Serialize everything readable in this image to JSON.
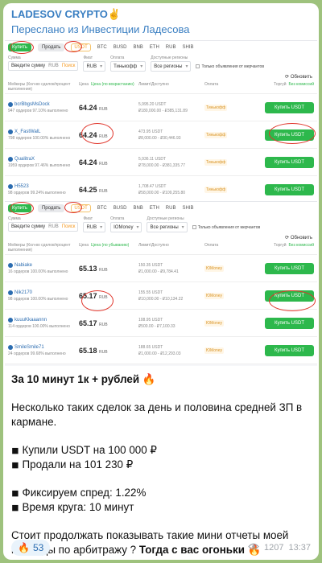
{
  "channel": {
    "name": "LADESOV CRYPTO✌️",
    "forwarded_from": "Переслано из Инвестиции Ладесова"
  },
  "shot1": {
    "tabs": {
      "buy": "Купить",
      "sell": "Продать",
      "assets": [
        "USDT",
        "BTC",
        "BUSD",
        "BNB",
        "ETH",
        "RUB",
        "SHIB"
      ]
    },
    "filters": {
      "amount_label": "Сумма",
      "amount_placeholder": "Введите сумму",
      "amount_currency": "RUB",
      "amount_search": "Поиск",
      "fiat_label": "Фиат",
      "fiat_value": "RUB",
      "payment_label": "Оплата",
      "payment_value": "Тинькофф",
      "regions_label": "Доступные регионы",
      "regions_value": "Все регионы",
      "merchant_check": "Только объявления от мерчантов"
    },
    "refresh": "Обновить",
    "headers": {
      "advertiser": "Мейкеры (Кол-во сделок/процент выполнения)",
      "price": "Цена",
      "price_sort": "Цена (по возрастанию)",
      "limit": "Лимит/Доступно",
      "payment": "Оплата",
      "trade": "Торгуй",
      "fee": "Без комиссий"
    },
    "rows": [
      {
        "name": "bcrBbgsMsDock",
        "sub": "947 ордеров   97.10% выполнено",
        "price": "64.24",
        "unit": "RUB",
        "avail": "5,995.20 USDT",
        "limit": "₽180,000.00 - ₽385,131.89",
        "pay": "Тинькофф",
        "action": "Купить USDT"
      },
      {
        "name": "X_FastWalL",
        "sub": "798 ордеров   100.00% выполнено",
        "price": "64.24",
        "unit": "RUB",
        "avail": "473.95 USDT",
        "limit": "₽8,000.00 - ₽30,446.93",
        "pay": "Тинькофф",
        "action": "Купить USDT"
      },
      {
        "name": "QualitraX",
        "sub": "1959 ордеров   97.46% выполнено",
        "price": "64.24",
        "unit": "RUB",
        "avail": "5,936.11 USDT",
        "limit": "₽78,000.00 - ₽381,335.77",
        "pay": "Тинькофф",
        "action": "Купить USDT"
      },
      {
        "name": "H5523",
        "sub": "98 ордеров   99.24% выполнено",
        "price": "64.25",
        "unit": "RUB",
        "avail": "1,708.47 USDT",
        "limit": "₽58,000.00 - ₽109,255.80",
        "pay": "Тинькофф",
        "action": "Купить USDT"
      }
    ]
  },
  "shot2": {
    "tabs": {
      "buy": "Купить",
      "sell": "Продать",
      "assets": [
        "USDT",
        "BTC",
        "BUSD",
        "BNB",
        "ETH",
        "RUB",
        "SHIB"
      ]
    },
    "filters": {
      "amount_label": "Сумма",
      "amount_placeholder": "Введите сумму",
      "amount_currency": "RUB",
      "amount_search": "Поиск",
      "fiat_label": "Фиат",
      "fiat_value": "RUB",
      "payment_label": "Оплата",
      "payment_value": "IOMoney",
      "regions_label": "Доступные регионы",
      "regions_value": "Все регионы",
      "merchant_check": "Только объявления от мерчантов"
    },
    "refresh": "Обновить",
    "headers": {
      "advertiser": "Мейкеры (Кол-во сделок/процент выполнения)",
      "price": "Цена",
      "price_sort": "Цена (по убыванию)",
      "limit": "Лимит/Доступно",
      "payment": "Оплата",
      "trade": "Торгуй",
      "fee": "Без комиссий"
    },
    "rows": [
      {
        "name": "Nabiake",
        "sub": "16 ордеров   100.00% выполнено",
        "price": "65.13",
        "unit": "RUB",
        "avail": "150.35 USDT",
        "limit": "₽1,000.00 - ₽9,784.41",
        "pay": "ЮMoney",
        "action": "Купить USDT"
      },
      {
        "name": "Nik2170",
        "sub": "98 ордеров   100.00% выполнено",
        "price": "65.17",
        "unit": "RUB",
        "avail": "155.55 USDT",
        "limit": "₽10,000.00 - ₽10,134.22",
        "pay": "ЮMoney",
        "action": "Купить USDT"
      },
      {
        "name": "kuuuKkaaannn",
        "sub": "114 ордеров   100.00% выполнено",
        "price": "65.17",
        "unit": "RUB",
        "avail": "108.95 USDT",
        "limit": "₽500.00 - ₽7,100.33",
        "pay": "ЮMoney",
        "action": "Купить USDT"
      },
      {
        "name": "SmileSmile71",
        "sub": "24 ордеров   99.68% выполнено",
        "price": "65.18",
        "unit": "RUB",
        "avail": "188.65 USDT",
        "limit": "₽1,000.00 - ₽12,293.03",
        "pay": "ЮMoney",
        "action": "Купить USDT"
      }
    ]
  },
  "message": {
    "title": "За 10 минут 1к + рублей 🔥",
    "para1": "Несколько таких сделок за день и половина средней ЗП в кармане.",
    "bought": "◾ Купили USDT на 100 000 ₽",
    "sold": "◾ Продали на 101 230 ₽",
    "spread": "◾ Фиксируем спред: 1.22%",
    "cycle": "◾ Время круга: 10 минут",
    "para2": "Стоит продолжать показывать такие мини отчеты моей команды по арбитражу ? ",
    "cta": "Тогда с вас огоньки 🔥"
  },
  "footer": {
    "reaction_emoji": "🔥",
    "reaction_count": "53",
    "views": "1207",
    "time": "13:37"
  }
}
